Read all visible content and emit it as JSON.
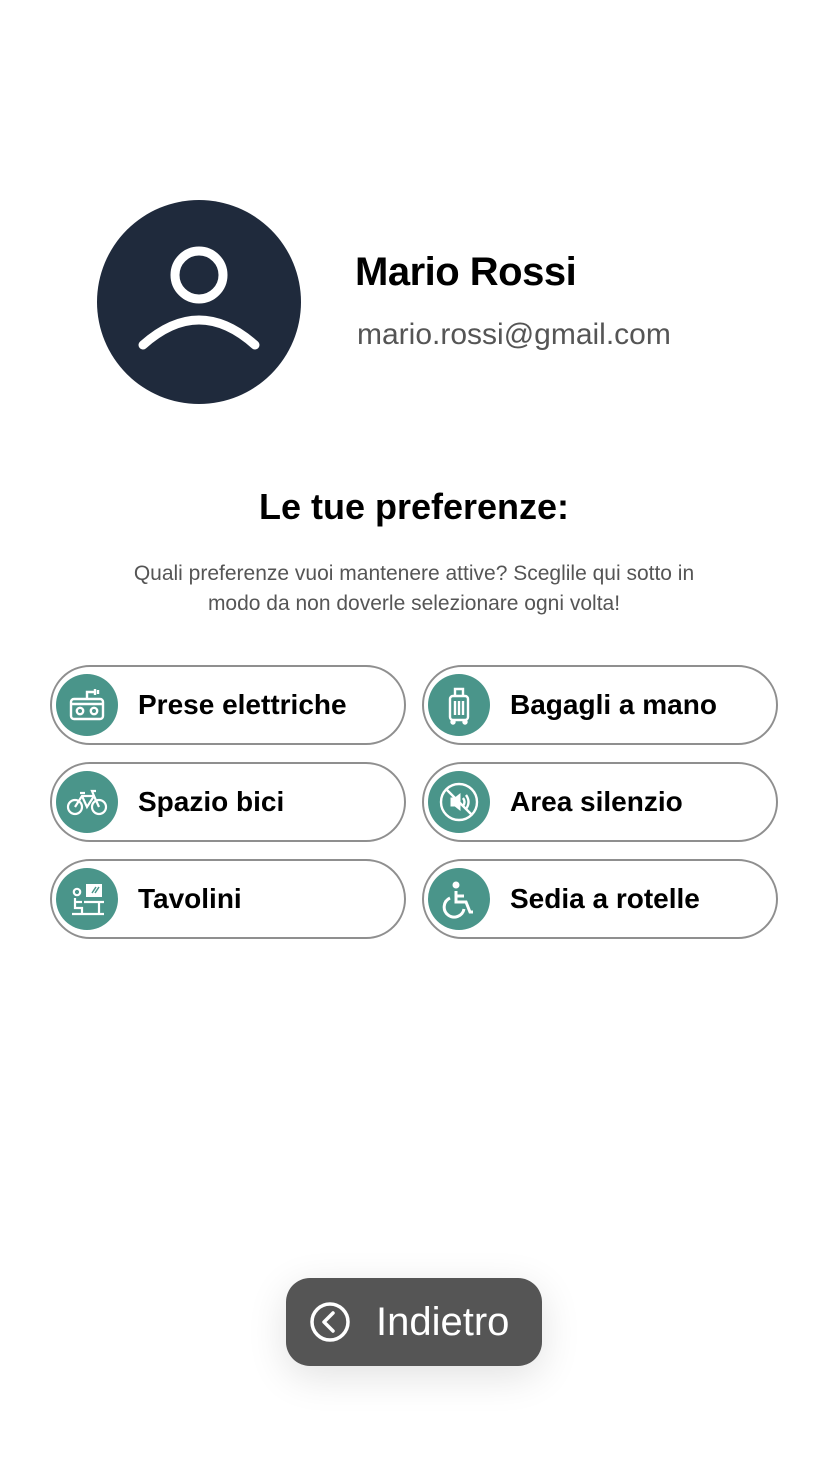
{
  "profile": {
    "name": "Mario Rossi",
    "email": "mario.rossi@gmail.com",
    "avatar_icon": "user-icon"
  },
  "preferences": {
    "title": "Le tue preferenze:",
    "description": "Quali preferenze vuoi mantenere attive? Sceglile qui sotto in modo da non doverle selezionare ogni volta!",
    "items": [
      {
        "label": "Prese elettriche",
        "icon": "power-outlet-icon"
      },
      {
        "label": "Bagagli a mano",
        "icon": "luggage-icon"
      },
      {
        "label": "Spazio bici",
        "icon": "bicycle-icon"
      },
      {
        "label": "Area silenzio",
        "icon": "silence-area-icon"
      },
      {
        "label": "Tavolini",
        "icon": "table-desk-icon"
      },
      {
        "label": "Sedia a rotelle",
        "icon": "wheelchair-icon"
      }
    ]
  },
  "navigation": {
    "back_label": "Indietro",
    "back_icon": "chevron-left-circle-icon"
  },
  "colors": {
    "avatar_bg": "#1f2a3c",
    "accent": "#4a958a",
    "button_bg": "#555555",
    "border": "#8f8f8f"
  }
}
